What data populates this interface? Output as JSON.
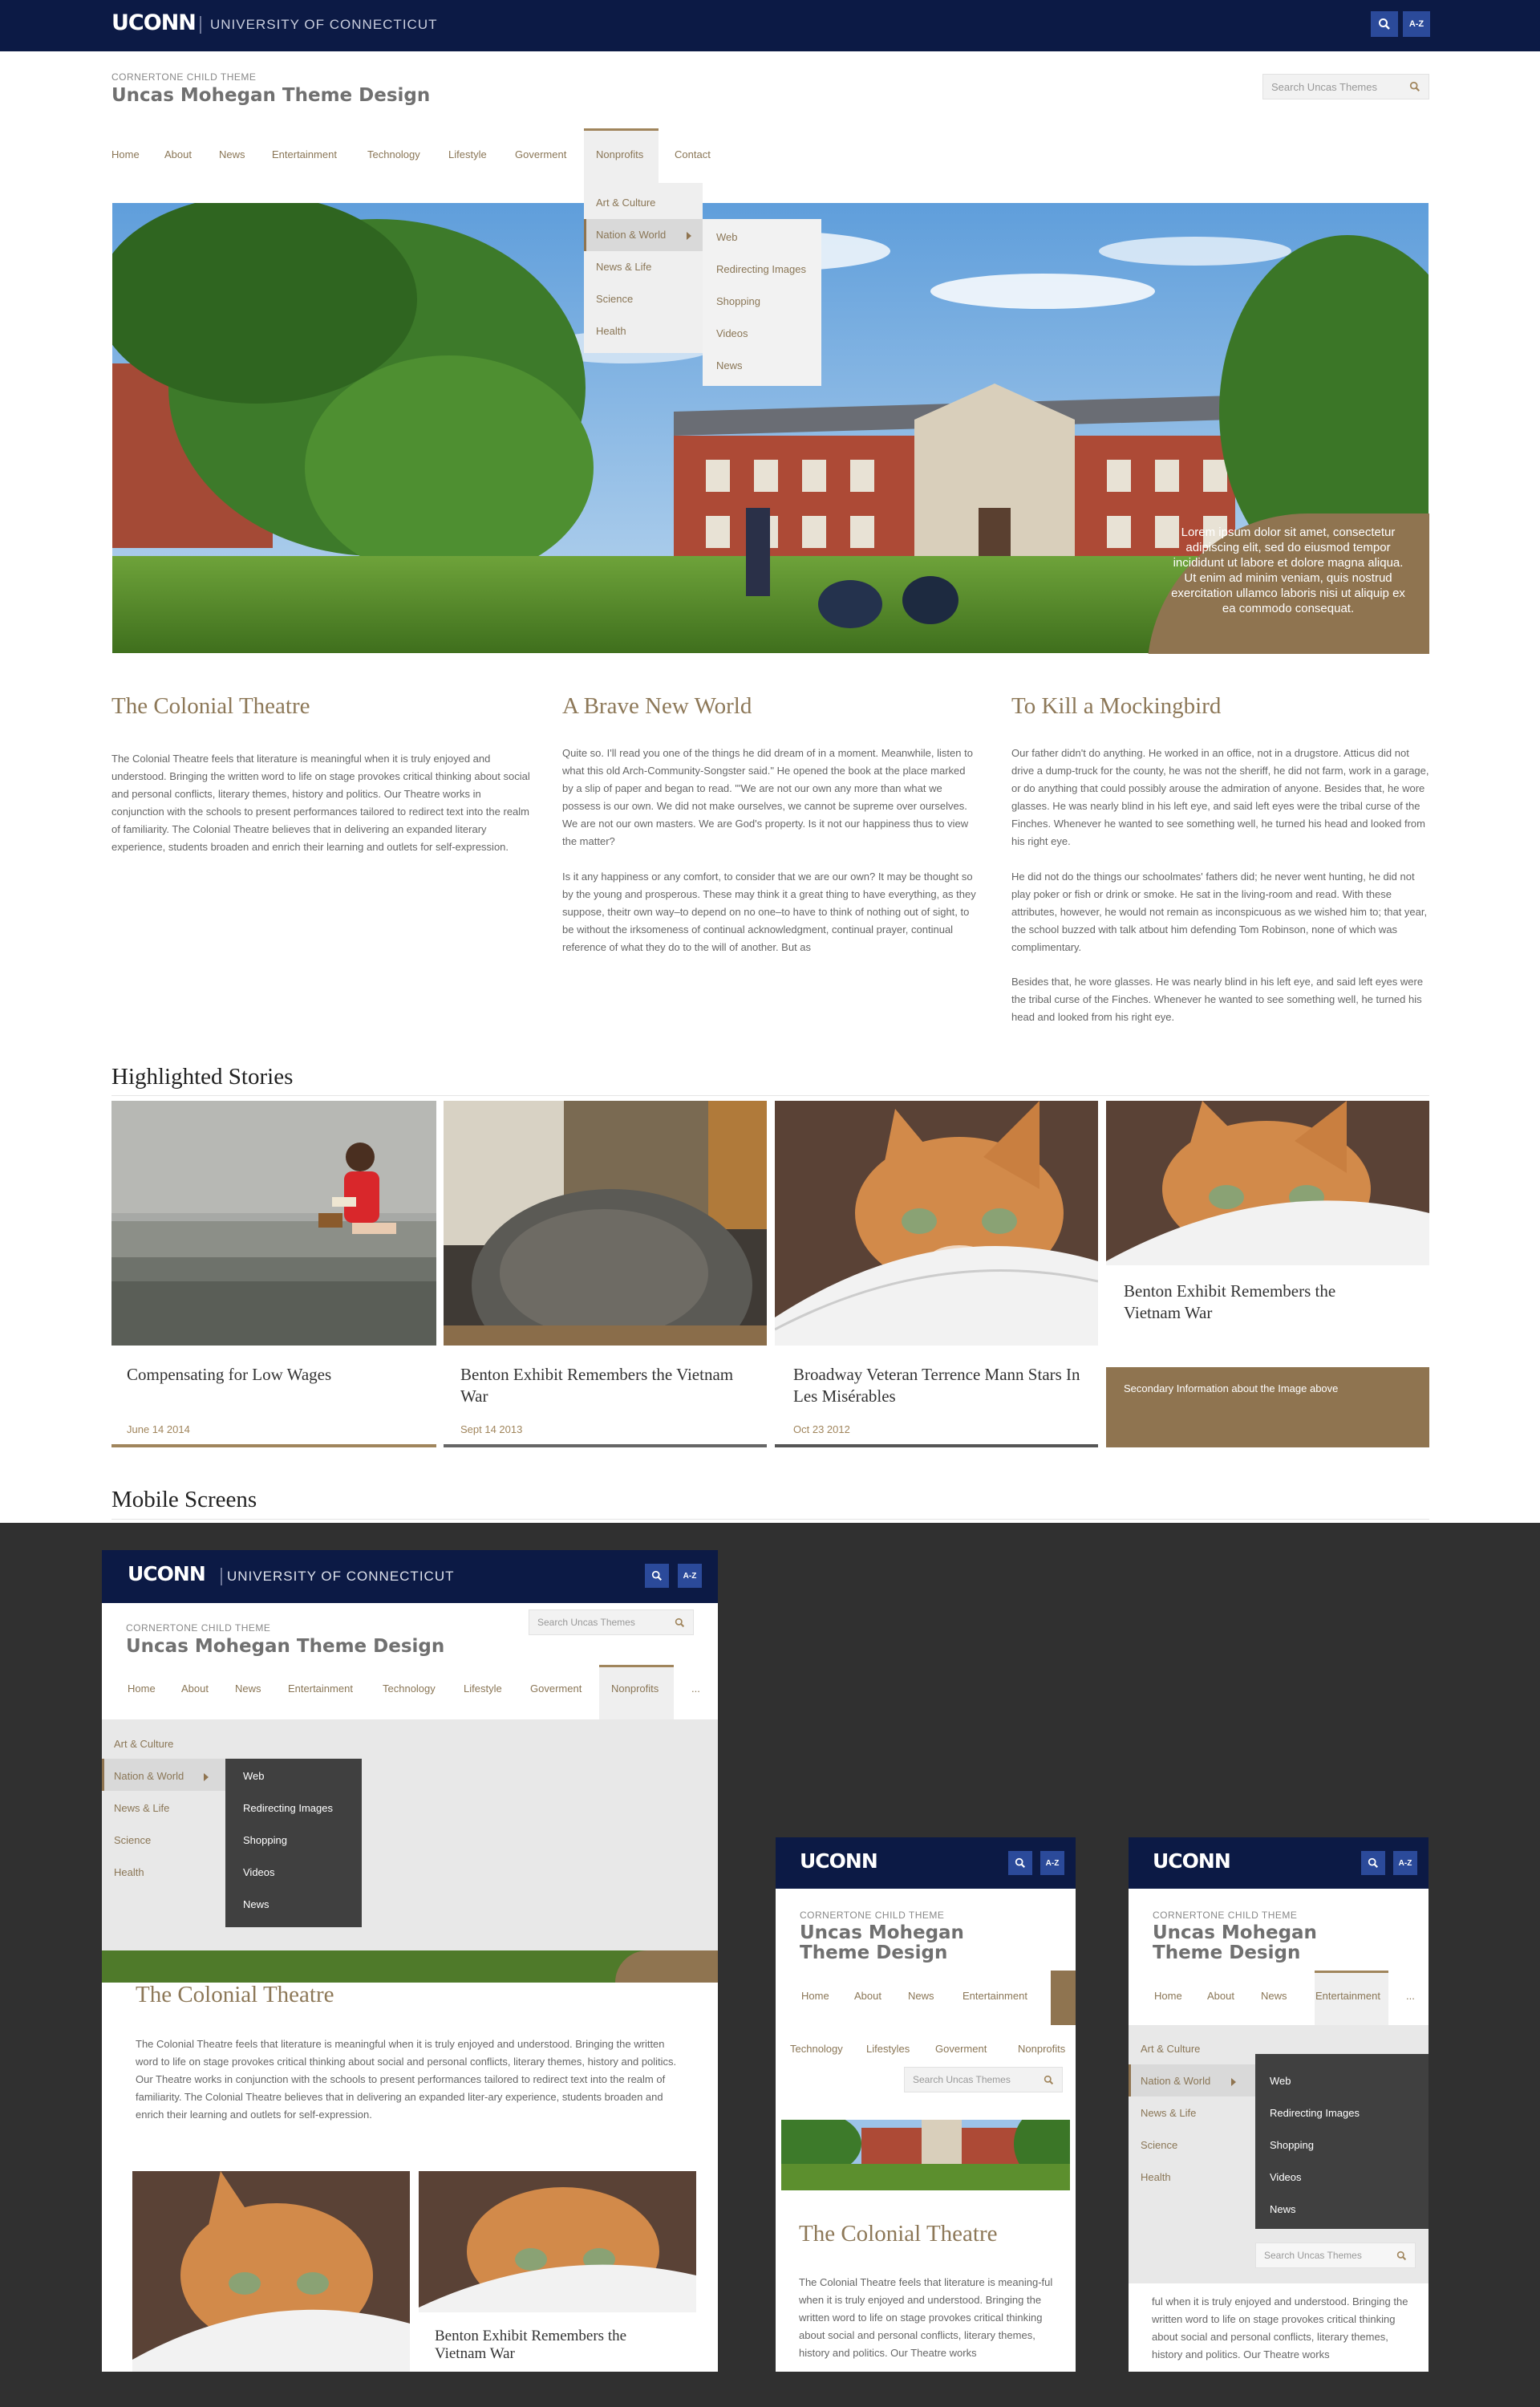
{
  "topbar": {
    "logo": "UCONN",
    "university": "UNIVERSITY OF CONNECTICUT",
    "search_icon": "search-icon",
    "az_label": "A-Z"
  },
  "header": {
    "kicker": "CORNERTONE CHILD THEME",
    "title": "Uncas Mohegan Theme Design",
    "search_placeholder": "Search Uncas Themes"
  },
  "nav": {
    "items": [
      "Home",
      "About",
      "News",
      "Entertainment",
      "Technology",
      "Lifestyle",
      "Goverment",
      "Nonprofits",
      "Contact"
    ],
    "active": "Nonprofits"
  },
  "dropdown": {
    "items": [
      "Art & Culture",
      "Nation & World",
      "News & Life",
      "Science",
      "Health"
    ],
    "submenu": [
      "Web",
      "Redirecting Images",
      "Shopping",
      "Videos",
      "News"
    ]
  },
  "hero": {
    "caption": "Lorem ipsum dolor sit amet, consectetur adipiscing elit, sed do eiusmod tempor incididunt ut labore et dolore magna aliqua. Ut enim ad minim veniam, quis nostrud exercitation ullamco laboris nisi ut aliquip ex ea commodo consequat."
  },
  "columns": [
    {
      "title": "The Colonial Theatre",
      "paragraphs": [
        "The Colonial Theatre feels that literature is meaningful when it is truly enjoyed and understood. Bringing the written word to life on stage provokes critical thinking about social and personal conflicts, literary themes, history and politics. Our Theatre works in conjunction with the schools to present performances tailored to redirect text into the realm of familiarity. The Colonial Theatre believes that in delivering an expanded literary experience, students broaden and enrich their learning and outlets for self-expression."
      ]
    },
    {
      "title": "A Brave New World",
      "paragraphs": [
        "Quite so. I'll read you one of the things he did dream of in a moment. Meanwhile, listen to what this old Arch-Community-Songster said.\" He opened the book at the place marked by a slip of paper and began to read. \"'We are not our own any more than what we possess is our own. We did not make ourselves, we cannot be supreme over ourselves. We are not our own masters. We are God's property. Is it not our happiness thus to view the matter?",
        "Is it any happiness or any comfort, to consider that we are our own? It may be thought so by the young and prosperous. These may think it a great thing to have everything, as they suppose, theitr own way–to depend on no one–to have to think of nothing out of sight, to be without the irksomeness of continual acknowledgment, continual prayer, continual reference of what they do to the will of another. But as"
      ]
    },
    {
      "title": "To Kill a Mockingbird",
      "paragraphs": [
        "Our father didn't do anything. He worked in an office, not in a drugstore. Atticus did not drive a dump-truck for the county, he was not the sheriff, he did not farm, work in a garage, or do anything that could possibly arouse the admiration of anyone. Besides that, he wore glasses. He was nearly blind in his left eye, and said left eyes were the tribal curse of the Finches. Whenever he wanted to see something well, he turned his head and looked from his right eye.",
        "He did not do the things our schoolmates' fathers did; he never went hunting, he did not play poker or fish or drink or smoke. He sat in the living-room and read. With these attributes, however, he would not remain as inconspicuous as we wished him to; that year, the school buzzed with talk atbout him defending Tom Robinson, none of which was complimentary.",
        "Besides that, he wore glasses. He was nearly blind in his left eye, and said left eyes were the tribal curse of the Finches. Whenever he wanted to see something well, he turned his head and looked from his right eye."
      ]
    }
  ],
  "highlighted": {
    "title": "Highlighted Stories",
    "cards": [
      {
        "title": "Compensating for Low Wages",
        "date": "June 14 2014"
      },
      {
        "title": "Benton Exhibit Remembers the Vietnam War",
        "date": "Sept 14 2013"
      },
      {
        "title": "Broadway Veteran Terrence Mann Stars In Les Misérables",
        "date": "Oct 23 2012"
      },
      {
        "title": "Benton Exhibit Remembers the Vietnam War",
        "secondary": "Secondary Information about the Image above"
      }
    ]
  },
  "mobile_section": {
    "title": "Mobile Screens"
  },
  "mobile": {
    "nav_more": "...",
    "tablet_nav": [
      "Home",
      "About",
      "News",
      "Entertainment",
      "Technology",
      "Lifestyle",
      "Goverment",
      "Nonprofits"
    ],
    "phone_nav_row1": [
      "Home",
      "About",
      "News",
      "Entertainment"
    ],
    "phone_nav_row2": [
      "Technology",
      "Lifestyles",
      "Goverment",
      "Nonprofits"
    ],
    "phone2_nav": [
      "Home",
      "About",
      "News",
      "Entertainment"
    ],
    "theatre_title": "The Colonial Theatre",
    "tablet_body": "The Colonial Theatre feels that literature is meaningful when it is truly enjoyed and understood. Bringing the written word to life on stage provokes critical thinking about social and personal conflicts, literary themes, history and politics. Our Theatre works in conjunction with the schools to present performances tailored to redirect text into the realm of familiarity. The Colonial Theatre believes that in delivering an expanded liter-ary experience, students broaden and enrich their learning and outlets for self-expression.",
    "phone_body": "The Colonial Theatre feels that literature is meaning-ful when it is truly enjoyed and understood. Bringing the written word to life on stage provokes critical thinking about social and personal conflicts, literary themes, history and politics. Our Theatre works",
    "phone2_body": "ful when it is truly enjoyed and understood. Bringing the written word to life on stage provokes critical thinking about social and personal conflicts, literary themes, history and politics. Our Theatre works",
    "tablet_card_title": "Benton Exhibit Remembers the Vietnam War"
  }
}
